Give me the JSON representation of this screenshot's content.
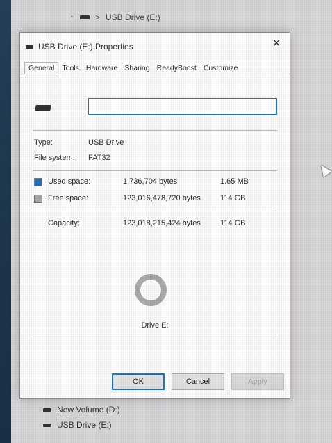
{
  "explorer": {
    "breadcrumb_sep": ">",
    "breadcrumb": "USB Drive (E:)",
    "items": [
      {
        "label": "New Volume (D:)"
      },
      {
        "label": "USB Drive (E:)"
      }
    ]
  },
  "dialog": {
    "title": "USB Drive (E:) Properties",
    "close_label": "✕",
    "tabs": [
      "General",
      "Tools",
      "Hardware",
      "Sharing",
      "ReadyBoost",
      "Customize"
    ],
    "active_tab": "General",
    "label_value": "",
    "type_label": "Type:",
    "type_value": "USB Drive",
    "fs_label": "File system:",
    "fs_value": "FAT32",
    "used": {
      "label": "Used space:",
      "bytes": "1,736,704 bytes",
      "human": "1.65 MB",
      "color": "#2a6fb4"
    },
    "free": {
      "label": "Free space:",
      "bytes": "123,016,478,720 bytes",
      "human": "114 GB",
      "color": "#a9a9a9"
    },
    "capacity": {
      "label": "Capacity:",
      "bytes": "123,018,215,424 bytes",
      "human": "114 GB"
    },
    "used_fraction": 1.41e-05,
    "drive_caption": "Drive E:",
    "buttons": {
      "ok": "OK",
      "cancel": "Cancel",
      "apply": "Apply"
    }
  }
}
